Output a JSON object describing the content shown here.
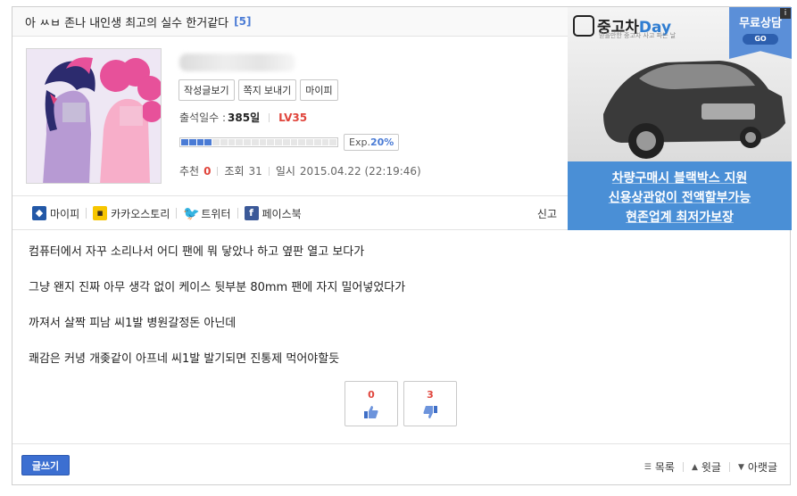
{
  "post": {
    "title": "아 ㅆㅂ 존나 내인생 최고의 실수 한거같다",
    "comment_count": "[5]"
  },
  "profile": {
    "buttons": [
      "작성글보기",
      "쪽지 보내기",
      "마이피"
    ],
    "attendance_label": "출석일수 :",
    "attendance_value": "385일",
    "level": "LV35",
    "exp_label": "Exp.",
    "exp_value": "20%",
    "exp_fraction": 0.2,
    "recommend_label": "추천",
    "recommend_value": "0",
    "views_label": "조회",
    "views_value": "31",
    "date_label": "일시",
    "date_value": "2015.04.22 (22:19:46)"
  },
  "share": {
    "items": [
      {
        "label": "마이피",
        "icon": "mypi-icon"
      },
      {
        "label": "카카오스토리",
        "icon": "kakaostory-icon"
      },
      {
        "label": "트위터",
        "icon": "twitter-icon"
      },
      {
        "label": "페이스북",
        "icon": "facebook-icon"
      }
    ],
    "report_label": "신고"
  },
  "ad": {
    "logo_text_main": "중고차",
    "logo_text_accent": "Day",
    "logo_sub": "믿을만한 중고차 사고 파는 날",
    "free_label": "무료상담",
    "go_label": "GO",
    "info_label": "i",
    "lines": [
      "차량구매시 블랙박스 지원",
      "신용상관없이 전액할부가능",
      "현존업계 최저가보장"
    ]
  },
  "body": {
    "paragraphs": [
      "컴퓨터에서 자꾸 소리나서 어디 팬에 뭐 닿았나 하고 옆판 열고 보다가",
      "그냥 왠지 진짜 아무 생각 없이 케이스 뒷부분 80mm 팬에 자지 밀어넣었다가",
      "까져서 살짝 피남 씨1발 병원갈정돈 아닌데",
      "쾌감은 커녕 개좆같이 아프네 씨1발 발기되면 진통제 먹어야할듯"
    ]
  },
  "vote": {
    "up_count": "0",
    "down_count": "3"
  },
  "footer": {
    "write_label": "글쓰기",
    "list_label": "목록",
    "prev_label": "윗글",
    "next_label": "아랫글"
  },
  "colors": {
    "accent_blue": "#4a7bd5",
    "accent_red": "#e0453c"
  }
}
